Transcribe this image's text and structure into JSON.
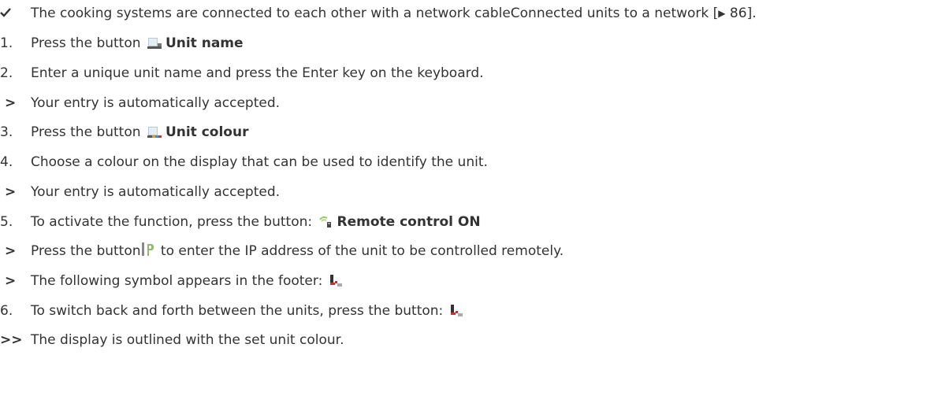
{
  "steps": {
    "prerequisite": {
      "marker": "✔",
      "text": "The cooking systems are connected to each other with a network cableConnected units to a network [",
      "ref_arrow": "▶",
      "ref_page": " 86]."
    },
    "step1": {
      "marker": "1.",
      "text": "Press the button ",
      "bold": "Unit name"
    },
    "step2": {
      "marker": "2.",
      "text": "Enter a unique unit name and press the Enter key on the keyboard."
    },
    "result2": {
      "marker": ">",
      "text": "Your entry is automatically accepted."
    },
    "step3": {
      "marker": "3.",
      "text": "Press the button ",
      "bold": "Unit colour"
    },
    "step4": {
      "marker": "4.",
      "text": "Choose a colour on the display that can be used to identify the unit."
    },
    "result4": {
      "marker": ">",
      "text": "Your entry is automatically accepted."
    },
    "step5": {
      "marker": "5.",
      "text": "To activate the function, press the button: ",
      "bold": "Remote control ON"
    },
    "result5a": {
      "marker": ">",
      "text_before": "Press the button",
      "text_after": " to enter the IP address of the unit to be controlled remotely."
    },
    "result5b": {
      "marker": ">",
      "text": "The following symbol appears in the footer: "
    },
    "step6": {
      "marker": "6.",
      "text": "To switch back and forth between the units, press the button: "
    },
    "final": {
      "marker": ">>",
      "text": "The display is outlined with the set unit colour."
    }
  },
  "icons": {
    "unit_name": "unit-name-icon",
    "unit_colour": "unit-colour-icon",
    "remote_control": "remote-control-icon",
    "ip_address": "ip-address-icon",
    "remote_symbol": "remote-symbol-icon"
  }
}
